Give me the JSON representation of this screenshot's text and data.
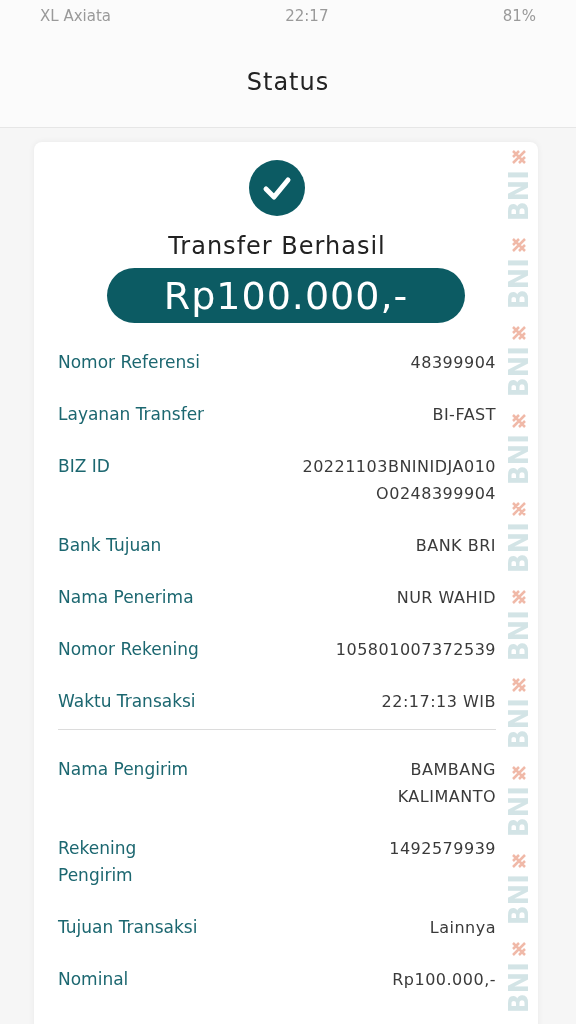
{
  "status_bar": {
    "carrier": "XL Axiata",
    "time": "22:17",
    "battery": "81%"
  },
  "header": {
    "title": "Status"
  },
  "receipt": {
    "result": "Transfer Berhasil",
    "amount": "Rp100.000,-",
    "side_pattern": [
      "BNI",
      "BNI",
      "BNI",
      "BNI",
      "BNI",
      "BNI",
      "BNI",
      "BNI",
      "BNI",
      "BNI"
    ],
    "sections": [
      {
        "rows": [
          {
            "label": [
              "Nomor Referensi"
            ],
            "value": [
              "48399904"
            ]
          },
          {
            "label": [
              "Layanan Transfer"
            ],
            "value": [
              "BI-FAST"
            ]
          },
          {
            "label": [
              "BIZ ID"
            ],
            "value": [
              "20221103BNINIDJA010",
              "O0248399904"
            ]
          },
          {
            "label": [
              "Bank Tujuan"
            ],
            "value": [
              "BANK BRI"
            ]
          },
          {
            "label": [
              "Nama Penerima"
            ],
            "value": [
              "NUR WAHID"
            ]
          },
          {
            "label": [
              "Nomor Rekening"
            ],
            "value": [
              "105801007372539"
            ]
          },
          {
            "label": [
              "Waktu Transaksi"
            ],
            "value": [
              "22:17:13 WIB"
            ]
          }
        ]
      },
      {
        "rows": [
          {
            "label": [
              "Nama Pengirim"
            ],
            "value": [
              "BAMBANG",
              "KALIMANTO"
            ]
          },
          {
            "label": [
              "Rekening",
              "Pengirim"
            ],
            "value": [
              "1492579939"
            ]
          },
          {
            "label": [
              "Tujuan Transaksi"
            ],
            "value": [
              "Lainnya"
            ]
          },
          {
            "label": [
              "Nominal"
            ],
            "value": [
              "Rp100.000,-"
            ]
          }
        ]
      }
    ]
  }
}
